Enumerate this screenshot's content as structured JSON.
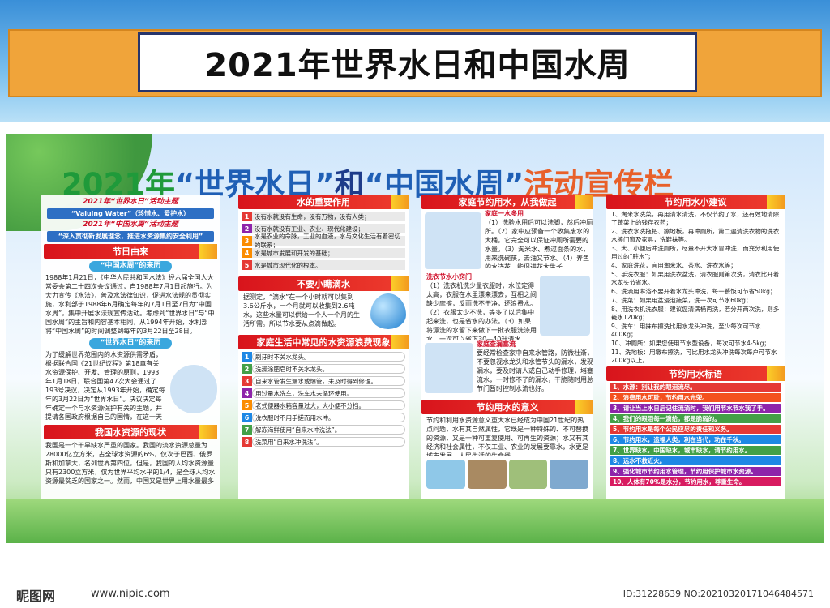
{
  "top_banner": {
    "title": "2021年世界水日和中国水周"
  },
  "board": {
    "title_parts": [
      "2021年",
      "“世界水日”",
      "和",
      "“中国水周”",
      "活动宣传栏"
    ]
  },
  "col1": {
    "wwd_line": "2021年“世界水日”活动主题",
    "wwd_theme": "“Valuing Water”（珍惜水、爱护水）",
    "cwd_line": "2021年“中国水周”活动主题",
    "cwd_theme": "“深入贯彻新发展理念，推进水资源集约安全利用”",
    "festival_header": "节日由来",
    "cwd_origin": "“中国水周”的来历",
    "cwd_text": "1988年1月21日，《中华人民共和国水法》经六届全国人大常委会第二十四次会议通过，自1988年7月1日起施行。为大力宣传《水法》，普及水法律知识，促进水法规的贯彻实施，水利部于1988年6月确定每年的7月1日至7日为“中国水周”，集中开展水法规宣传活动。考虑到“世界水日”与“中国水周”的主旨和内容基本相同，从1994年开始，水利部将“中国水周”的时间调整到每年的3月22日至28日。",
    "wwd_origin": "“世界水日”的来历",
    "wwd_text": "为了缓解世界范围内的水资源供需矛盾，根据联合国《21世纪议程》第18章有关水资源保护、开发、管理的原则，1993年1月18日，联合国第47次大会通过了193号决议，决定从1993年开始，确定每年的3月22日为“世界水日”。决议决定每年确定一个与水资源保护有关的主题，并提请各国政府根据自己的国情，在这一天围绕主题开展如出版、散发宣传品，举行会议、展览等宣传活动，以提高公众意识。",
    "status_header": "我国水资源的现状",
    "status_text": "我国是一个干旱缺水严重的国家。我国的淡水资源总量为28000亿立方米，占全球水资源的6%，仅次于巴西、俄罗斯和加拿大，名列世界第四位，但是，我国的人均水资源量只有2300立方米，仅为世界平均水平的1/4，是全球人均水资源最贫乏的国家之一。然而，中国又是世界上用水量最多的国家。"
  },
  "col2": {
    "importance_header": "水的重要作用",
    "importance_items": [
      "没有水就没有生命，没有万物，没有人类；",
      "没有水就没有工业、农业、现代化建设；",
      "水是农业的命脉，工业的血液，水与文化生活有着密切的联系；",
      "水是城市发展和开发的基础；",
      "水是城市现代化的根本。"
    ],
    "drip_header": "不要小瞧滴水",
    "drip_text": "据测定，“滴水”在一个小时就可以集到3.6公斤水，一个月就可以收集到2.6吨水，这些水量可以供给一个人一个月的生活所需。所以节水要从点滴做起。",
    "waste_header": "家庭生活中常见的水资源浪费现象",
    "waste_items": [
      "刷牙时不关水龙头。",
      "洗澡涂肥皂时不关水龙头。",
      "自来水管发生漏水或爆管，未及时得到修理。",
      "用过量水洗车，洗车水未循环使用。",
      "老式便器水箱容量过大，大小便不分挡。",
      "洗衣服时不用手搓而用水冲。",
      "解冻海鲜使用“自来水冲洗法”。",
      "洗菜用“自来水冲洗法”。"
    ]
  },
  "col3": {
    "home_header": "家庭节约用水，从我做起",
    "tip1_label": "家庭一水多用",
    "tip1_text": "（1）洗脸水用后可以洗脚，然后冲厕所。（2）家中应预备一个收集废水的大桶，它完全可以保证冲厕所需要的水量。（3）淘米水、煮过面条的水，用来洗碗筷，去油又节水。（4）养鱼的水浇花，能促进花木生长。",
    "tip2_label": "洗衣节水小窍门",
    "tip2_text": "（1）洗衣机洗少量衣服时，水位定得太高，衣服在水里漂来漂去，互相之间缺少摩擦，反而洗不干净，还浪费水。（2）衣服太少不洗，等多了以后集中起来洗，也是省水的办法。（3）如果将漂洗的水留下来做下一批衣服洗涤用水，一次可以省下30—40升清水。",
    "tip3_label": "家庭查漏塞流",
    "tip3_text": "要经常检查家中自来水管路，防微杜渐，不要忽视水龙头和水管节头的漏水，发现漏水，要及时请人或自己动手修理，堵塞流水，一时修不了的漏水，干脆随时用总节门暂时控制水流也好。",
    "meaning_header": "节约用水的意义",
    "meaning_text": "节约和利用水资源意义重大水已经成为中国21世纪的热点问题，水有其自然属性，它既是一种特殊的、不可替换的资源，又是一种可重复使用、可再生的资源；水又有其经济和社会属性，不仅工业、农业的发展要靠水，水更是城市发展、人民生活的生命线。"
  },
  "col4": {
    "tips_header": "节约用水小建议",
    "tips": [
      "1、淘米水洗菜，再用清水清洗，不仅节约了水，还有效地清除了蔬菜上的残存农药；",
      "2、洗衣水洗拖把、擦地板，再冲厕所，第二遍清洗衣物的洗衣水擦门窗及家具，洗鞋袜等。",
      "3、大、小便后冲洗厕所，尽量不开大水冒冲洗，而充分利用使用过的“脏水”；",
      "4、家庭洗花，宜用淘米水、茶水、洗衣水等；",
      "5、手洗衣服：如果用洗衣盆洗，清衣服则第次洗，清衣比开着水龙头节省水。",
      "6、洗澡用淋浴不要开着水龙头冲洗，每一餐饭可节省50kg；",
      "7、洗菜：如果用盆浸泡蔬菜，洗一次可节水60kg；",
      "8、用洗衣机洗衣服：建议您清满桶再洗，若分开两次洗，则多耗水120kg；",
      "9、洗车：用抹布擦洗比用水龙头冲洗，至少每次可节水400Kg；",
      "10、冲厕所：如果您使用节水型设备，每次可节水4-5kg；",
      "11、洗地板：用墩布擦洗，可比用水龙头冲洗每次每户可节水200kg以上。"
    ],
    "slogans_header": "节约用水标语",
    "slogans": [
      "1、水源：别让我的眼泪流尽。",
      "2、浪费用水可耻，节约用水光荣。",
      "3、请让当上水日后记住流淌时，我们用节水节水我了手。",
      "4、我们的眼泪每一滴给，都是脆弱的。",
      "5、节约用水是每个公民应尽的责任和义务。",
      "6、节约用水，造福人类，利在当代，功在千秋。",
      "7、世界缺水，中国缺水，城市缺水，请节约用水。",
      "8、远水不救近火。",
      "9、强化城市节约用水管理，节约用保护城市水资源。",
      "10、人体有70%是水分，节约用水，尊重生命。"
    ],
    "slogan_colors": [
      "#e53935",
      "#f4511e",
      "#8e24aa",
      "#43a047",
      "#e53935",
      "#1e88e5",
      "#43a047",
      "#1e88e5",
      "#8e24aa",
      "#d81b60"
    ]
  },
  "footer": {
    "logo": "昵图网",
    "url": "www.nipic.com",
    "id": "ID:31228639 NO:20210320171046484571"
  },
  "num_colors": [
    "#e53935",
    "#8e24aa",
    "#fb8c00",
    "#fb8c00",
    "#e53935"
  ],
  "waste_num_colors": [
    "#1e88e5",
    "#43a047",
    "#e53935",
    "#8e24aa",
    "#fb8c00",
    "#1e88e5",
    "#43a047",
    "#e53935"
  ]
}
